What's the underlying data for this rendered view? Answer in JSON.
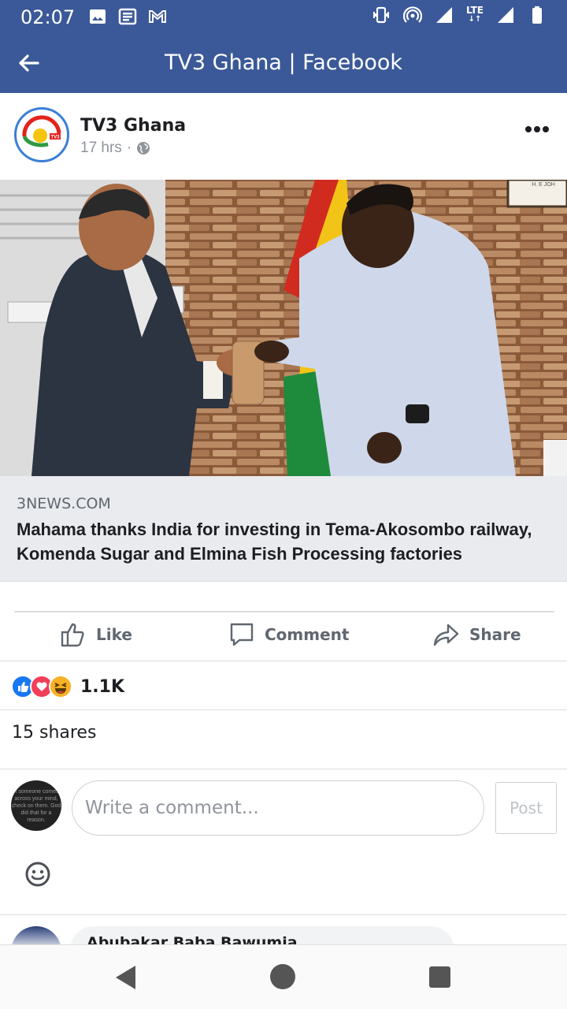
{
  "status_bar": {
    "time": "02:07",
    "left_icons": [
      "image-icon",
      "news-icon",
      "gmail-icon"
    ],
    "right_icons": [
      "vibrate-icon",
      "hotspot-icon",
      "signal-icon",
      "lte-icon",
      "signal-icon",
      "battery-icon"
    ],
    "network_label": "LTE"
  },
  "app_bar": {
    "title": "TV3 Ghana | Facebook",
    "background": "#3b5998"
  },
  "post": {
    "page_name": "TV3 Ghana",
    "time_ago": "17 hrs",
    "separator": "·",
    "privacy_icon": "globe-icon",
    "avatar_text": "TV3"
  },
  "link": {
    "domain": "3NEWS.COM",
    "title": "Mahama thanks India for investing in Tema-Akosombo railway, Komenda Sugar and Elmina Fish Processing factories"
  },
  "photo": {
    "corner_label": "H. E JOH"
  },
  "actions": {
    "like": "Like",
    "comment": "Comment",
    "share": "Share"
  },
  "reactions": {
    "icons": [
      "like-icon",
      "love-icon",
      "haha-icon"
    ],
    "count": "1.1K",
    "colors": {
      "like": "#1877f2",
      "love": "#f33e58",
      "haha": "#f7b125"
    }
  },
  "shares": {
    "text": "15 shares"
  },
  "comment_box": {
    "placeholder": "Write a comment...",
    "post_label": "Post",
    "avatar_text": "If someone comes across your mind, check on them. God did that for a reason."
  },
  "next_comment": {
    "author": "Abubakar Baba Bawumia"
  }
}
